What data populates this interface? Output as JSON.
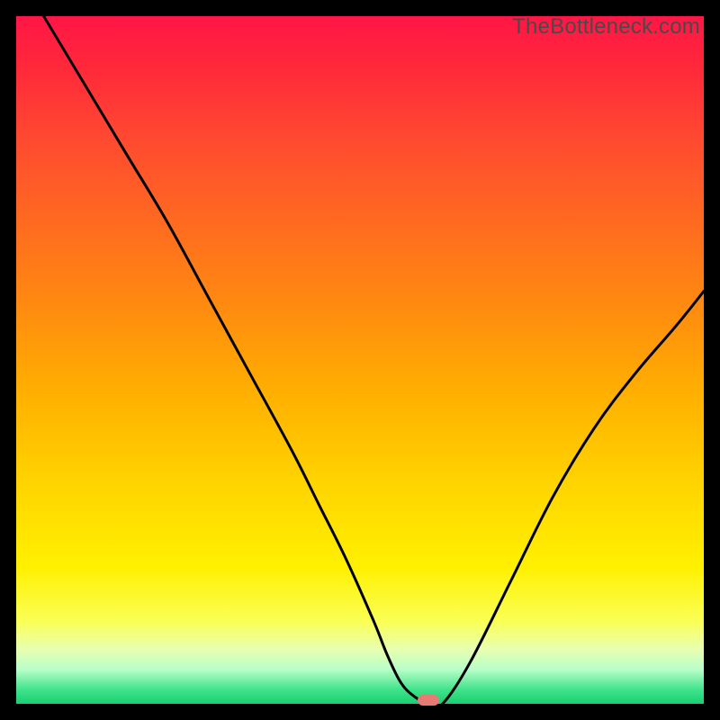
{
  "watermark": "TheBottleneck.com",
  "chart_data": {
    "type": "line",
    "title": "",
    "xlabel": "",
    "ylabel": "",
    "xlim": [
      0,
      100
    ],
    "ylim": [
      0,
      100
    ],
    "x": [
      4,
      10,
      16,
      22,
      28,
      34,
      40,
      44,
      48,
      52,
      54,
      56,
      58,
      60,
      62,
      66,
      72,
      78,
      84,
      90,
      96,
      100
    ],
    "values": [
      100,
      90,
      80,
      70,
      59,
      48,
      37,
      29,
      21,
      12,
      7,
      3,
      1,
      0,
      0,
      6,
      18,
      30,
      40,
      48,
      55,
      60
    ],
    "minimum_x": 60,
    "marker_color": "#e77a74"
  },
  "gradient_stops": [
    {
      "pos": 0,
      "color": "#ff1646"
    },
    {
      "pos": 8,
      "color": "#ff2a3a"
    },
    {
      "pos": 18,
      "color": "#ff4a30"
    },
    {
      "pos": 30,
      "color": "#ff6a20"
    },
    {
      "pos": 42,
      "color": "#ff8a10"
    },
    {
      "pos": 55,
      "color": "#ffb000"
    },
    {
      "pos": 68,
      "color": "#ffd400"
    },
    {
      "pos": 80,
      "color": "#fff000"
    },
    {
      "pos": 88,
      "color": "#faff55"
    },
    {
      "pos": 92,
      "color": "#e9ffb0"
    },
    {
      "pos": 95,
      "color": "#b8ffc8"
    },
    {
      "pos": 98,
      "color": "#3fe28a"
    },
    {
      "pos": 100,
      "color": "#18d070"
    }
  ]
}
